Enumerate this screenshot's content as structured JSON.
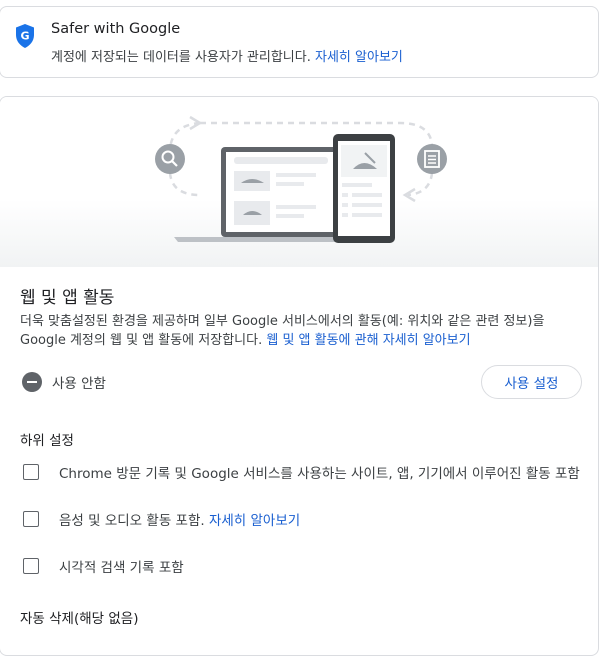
{
  "safer": {
    "title": "Safer with Google",
    "desc": "계정에 저장되는 데이터를 사용자가 관리합니다.",
    "link": "자세히 알아보기"
  },
  "activity": {
    "title": "웹 및 앱 활동",
    "desc_line": "더욱 맞춤설정된 환경을 제공하며 일부 Google 서비스에서의 활동(예: 위치와 같은 관련 정보)을 Google 계정의 웹 및 앱 활동에 저장합니다.",
    "desc_link": "웹 및 앱 활동에 관해 자세히 알아보기",
    "status": "사용 안함",
    "enable_button": "사용 설정"
  },
  "subsettings": {
    "title": "하위 설정",
    "items": [
      {
        "label": "Chrome 방문 기록 및 Google 서비스를 사용하는 사이트, 앱, 기기에서 이루어진 활동 포함",
        "checked": false
      },
      {
        "label": "음성 및 오디오 활동 포함.",
        "link": "자세히 알아보기",
        "checked": false
      },
      {
        "label": "시각적 검색 기록 포함",
        "checked": false
      }
    ]
  },
  "auto_delete": {
    "title": "자동 삭제(해당 없음)"
  },
  "icons": {
    "shield": "google-shield-icon",
    "search": "search-icon",
    "document": "document-icon",
    "status": "minus-circle-icon"
  },
  "colors": {
    "link": "#1a5fd0",
    "shield": "#1a73e8",
    "text": "#202124",
    "muted": "#5f6368"
  }
}
